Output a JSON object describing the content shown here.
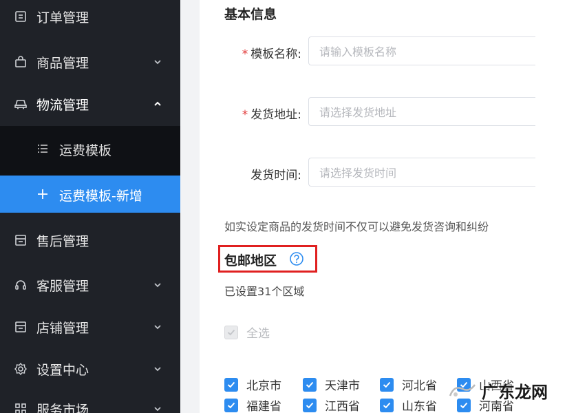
{
  "sidebar": {
    "items": [
      {
        "label": "订单管理",
        "icon": "order-list-icon"
      },
      {
        "label": "商品管理",
        "icon": "shopping-bag-icon"
      },
      {
        "label": "物流管理",
        "icon": "truck-icon"
      },
      {
        "label": "售后管理",
        "icon": "after-sale-icon"
      },
      {
        "label": "客服管理",
        "icon": "headset-icon"
      },
      {
        "label": "店铺管理",
        "icon": "store-icon"
      },
      {
        "label": "设置中心",
        "icon": "gear-icon"
      },
      {
        "label": "服务市场",
        "icon": "grid-icon"
      }
    ],
    "sub_items": [
      {
        "label": "运费模板",
        "icon": "list-icon"
      },
      {
        "label": "运费模板-新增",
        "icon": "plus-icon"
      }
    ],
    "active_color": "#2d8cf0"
  },
  "form": {
    "section_title": "基本信息",
    "template_name": {
      "label": "模板名称:",
      "placeholder": "请输入模板名称"
    },
    "ship_address": {
      "label": "发货地址:",
      "placeholder": "请选择发货地址"
    },
    "ship_time": {
      "label": "发货时间:",
      "placeholder": "请选择发货时间"
    },
    "hint": "如实设定商品的发货时间不仅可以避免发货咨询和纠纷"
  },
  "free_shipping": {
    "title": "包邮地区",
    "region_count": "已设置31个区域",
    "select_all": "全选",
    "provinces_row1": [
      "北京市",
      "天津市",
      "河北省",
      "山西省"
    ],
    "provinces_row2": [
      "福建省",
      "江西省",
      "山东省",
      "河南省"
    ]
  },
  "watermark": {
    "text": "广东龙网"
  }
}
